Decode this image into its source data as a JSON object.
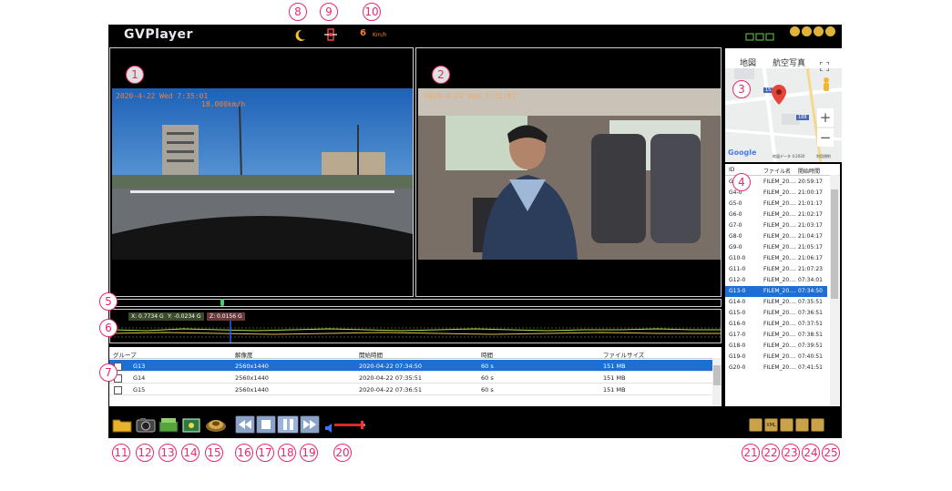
{
  "app": {
    "title": "GVPlayer",
    "speed_value": "6",
    "speed_unit": "Km/h"
  },
  "video_front": {
    "osd_datetime": "2020-4-22 Wed 7:35:01",
    "osd_speed": "18.000km/h"
  },
  "video_rear": {
    "osd_datetime": "2020-4-22 Wed 7:35:01"
  },
  "map": {
    "tab_map": "地図",
    "tab_aerial": "航空写真",
    "zoom_in": "+",
    "zoom_out": "−",
    "google": "Google",
    "attribution": "地図データ ©2020",
    "terms": "利用規約",
    "route_badge": "152",
    "route_badge2": "188"
  },
  "gsensor": {
    "x": "X: 0.7734 G",
    "y": "Y: -0.0234 G",
    "z": "Z: 0.0156 G"
  },
  "file_table": {
    "headers": [
      "グループ",
      "解像度",
      "開始時間",
      "時間",
      "ファイルサイズ"
    ],
    "rows": [
      {
        "group": "G13",
        "res": "2560x1440",
        "start": "2020-04-22 07:34:50",
        "dur": "60 s",
        "size": "151 MB"
      },
      {
        "group": "G14",
        "res": "2560x1440",
        "start": "2020-04-22 07:35:51",
        "dur": "60 s",
        "size": "151 MB"
      },
      {
        "group": "G15",
        "res": "2560x1440",
        "start": "2020-04-22 07:36:51",
        "dur": "60 s",
        "size": "151 MB"
      }
    ]
  },
  "id_list": {
    "headers": [
      "ID",
      "ファイル名",
      "開始時間"
    ],
    "rows": [
      {
        "id": "G3-0",
        "name": "FILEM_20....",
        "time": "20:59:17"
      },
      {
        "id": "G4-0",
        "name": "FILEM_20....",
        "time": "21:00:17"
      },
      {
        "id": "G5-0",
        "name": "FILEM_20....",
        "time": "21:01:17"
      },
      {
        "id": "G6-0",
        "name": "FILEM_20....",
        "time": "21:02:17"
      },
      {
        "id": "G7-0",
        "name": "FILEM_20....",
        "time": "21:03:17"
      },
      {
        "id": "G8-0",
        "name": "FILEM_20....",
        "time": "21:04:17"
      },
      {
        "id": "G9-0",
        "name": "FILEM_20....",
        "time": "21:05:17"
      },
      {
        "id": "G10-0",
        "name": "FILEM_20....",
        "time": "21:06:17"
      },
      {
        "id": "G11-0",
        "name": "FILEM_20....",
        "time": "21:07:23"
      },
      {
        "id": "G12-0",
        "name": "FILEM_20....",
        "time": "07:34:01"
      },
      {
        "id": "G13-0",
        "name": "FILEM_20....",
        "time": "07:34:50"
      },
      {
        "id": "G14-0",
        "name": "FILEM_20....",
        "time": "07:35:51"
      },
      {
        "id": "G15-0",
        "name": "FILEM_20....",
        "time": "07:36:51"
      },
      {
        "id": "G16-0",
        "name": "FILEM_20....",
        "time": "07:37:51"
      },
      {
        "id": "G17-0",
        "name": "FILEM_20....",
        "time": "07:38:51"
      },
      {
        "id": "G18-0",
        "name": "FILEM_20....",
        "time": "07:39:51"
      },
      {
        "id": "G19-0",
        "name": "FILEM_20....",
        "time": "07:40:51"
      },
      {
        "id": "G20-0",
        "name": "FILEM_20....",
        "time": "07:41:51"
      }
    ]
  },
  "toolbar": {
    "xml_label": "XML"
  },
  "colors": {
    "selected_row": "#1e6fd4",
    "callout": "#e6286e",
    "osd": "#ff7d2f",
    "background": "#000000"
  },
  "callouts": [
    "1",
    "2",
    "3",
    "4",
    "5",
    "6",
    "7",
    "8",
    "9",
    "10",
    "11",
    "12",
    "13",
    "14",
    "15",
    "16",
    "17",
    "18",
    "19",
    "20",
    "21",
    "22",
    "23",
    "24",
    "25"
  ]
}
